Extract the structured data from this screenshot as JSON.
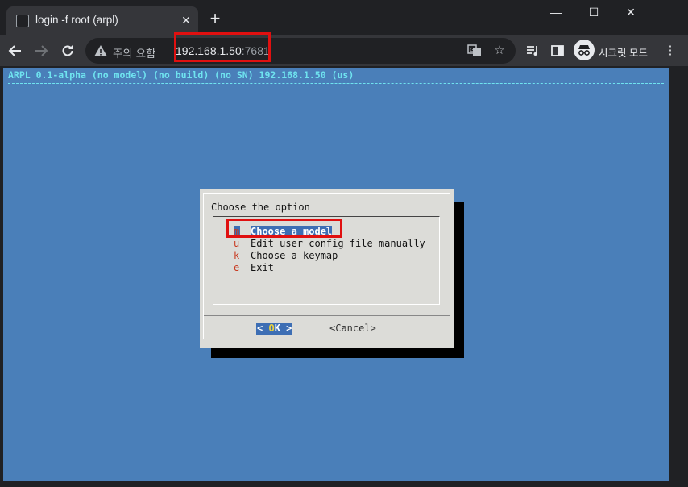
{
  "browser": {
    "tab": {
      "title": "login -f root (arpl)"
    },
    "window_controls": {
      "minimize": "—",
      "maximize": "☐",
      "close": "✕"
    },
    "address_bar": {
      "security_text": "주의 요함",
      "url_host": "192.168.1.50",
      "url_port": ":7681"
    },
    "incognito_label": "시크릿 모드"
  },
  "terminal": {
    "header": "ARPL 0.1-alpha (no model) (no build) (no SN) 192.168.1.50 (us)",
    "dialog": {
      "title": "Choose the option",
      "items": [
        {
          "key": "m",
          "label": "Choose a model",
          "selected": true
        },
        {
          "key": "u",
          "label": "Edit user config file manually",
          "selected": false
        },
        {
          "key": "k",
          "label": "Choose a keymap",
          "selected": false
        },
        {
          "key": "e",
          "label": "Exit",
          "selected": false
        }
      ],
      "ok_button": {
        "left": "< ",
        "hot": "O",
        "rest": "K",
        "right": " >"
      },
      "cancel_button": "<Cancel>"
    }
  },
  "colors": {
    "terminal_bg": "#4a7fb9",
    "header_fg": "#6fe3ef",
    "dialog_bg": "#dcdcd8",
    "selection_bg": "#3d6eb4",
    "hotkey_fg": "#c8381e",
    "annotation_red": "#e01010"
  }
}
